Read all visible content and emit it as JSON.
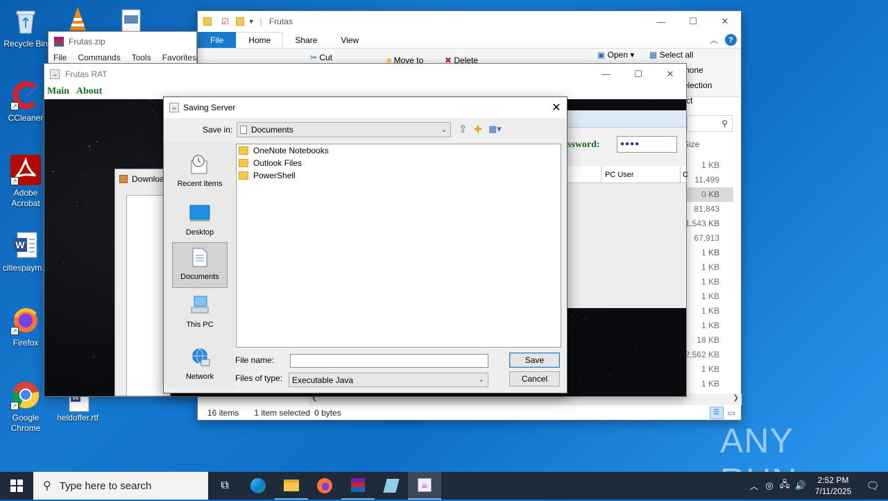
{
  "desktop": {
    "icons": [
      {
        "label": "Recycle Bin",
        "icon": "recycle-bin-icon"
      },
      {
        "label": "CCleaner",
        "icon": "ccleaner-icon"
      },
      {
        "label": "Adobe Acrobat",
        "icon": "acrobat-icon"
      },
      {
        "label": "citiespaym...",
        "icon": "word-doc-icon"
      },
      {
        "label": "Firefox",
        "icon": "firefox-icon"
      },
      {
        "label": "Google Chrome",
        "icon": "chrome-icon"
      },
      {
        "label": "heldoffer.rtf",
        "icon": "rtf-doc-icon"
      }
    ],
    "watermark": "ANY RUN"
  },
  "winrar": {
    "title": "Frutas.zip",
    "menu": [
      "File",
      "Commands",
      "Tools",
      "Favorites"
    ]
  },
  "explorer": {
    "title": "Frutas",
    "tabs": [
      "File",
      "Home",
      "Share",
      "View"
    ],
    "ribbon": {
      "cut": "Cut",
      "move_to": "Move to",
      "delete": "Delete",
      "open": "Open",
      "select_all": "Select all",
      "select_none": "none",
      "invert_selection": "election",
      "ct": "ct"
    },
    "size_header": "Size",
    "sizes": [
      "1 KB",
      "11,499 KB",
      "0 KB",
      "81,843 KB",
      "1,543 KB",
      "67,913 KB",
      "1 KB",
      "1 KB",
      "1 KB",
      "1 KB",
      "1 KB",
      "1 KB",
      "18 KB",
      "2,562 KB",
      "1 KB",
      "1 KB"
    ],
    "status": {
      "items": "16 items",
      "selected": "1 item selected",
      "bytes": "0 bytes"
    }
  },
  "rat": {
    "title": "Frutas RAT",
    "menu": [
      "Main",
      "About"
    ],
    "password_label": "ssword:",
    "password_value": "●●●●",
    "col_pc_user": "PC User",
    "col_c": "C",
    "download_title": "Downloa"
  },
  "dialog": {
    "title": "Saving Server",
    "save_in_label": "Save in:",
    "save_in_value": "Documents",
    "places": [
      "Recent Items",
      "Desktop",
      "Documents",
      "This PC",
      "Network"
    ],
    "selected_place": "Documents",
    "files": [
      "OneNote Notebooks",
      "Outlook Files",
      "PowerShell"
    ],
    "file_name_label": "File name:",
    "file_name_value": "",
    "files_of_type_label": "Files of type:",
    "files_of_type_value": "Executable Java",
    "save_button": "Save",
    "cancel_button": "Cancel"
  },
  "taskbar": {
    "search_placeholder": "Type here to search",
    "time": "2:52 PM",
    "date": "7/11/2025"
  }
}
